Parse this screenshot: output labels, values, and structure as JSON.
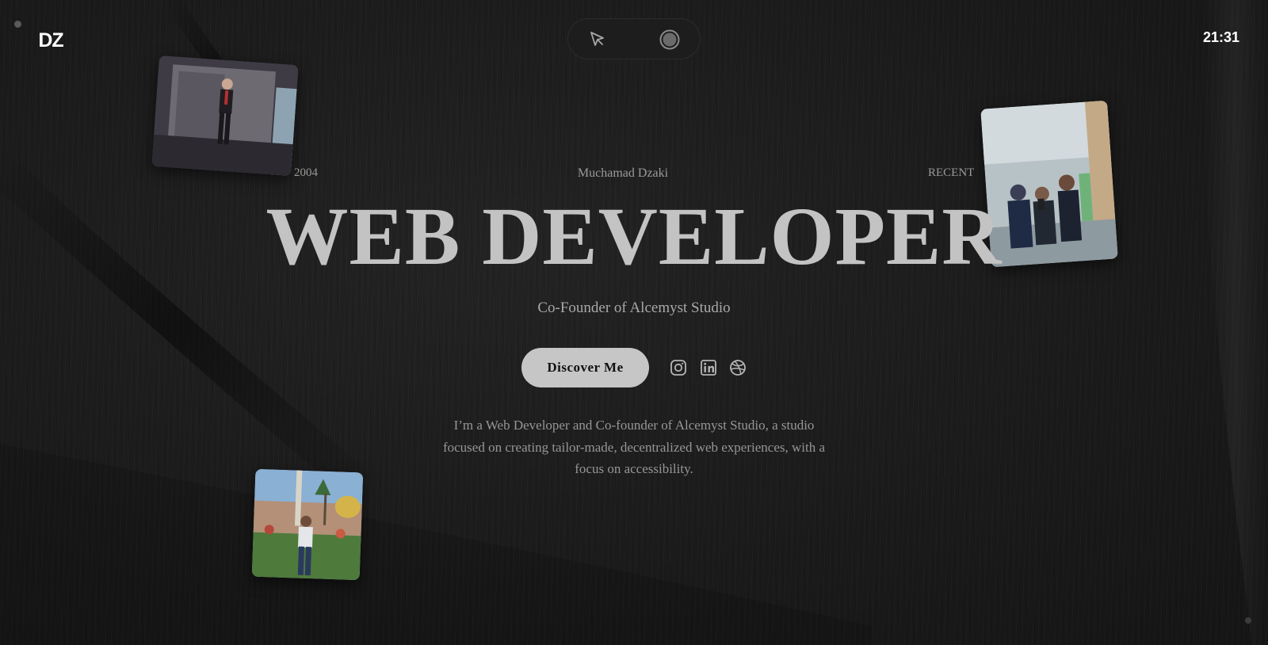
{
  "brand": {
    "logo_text": "DZ"
  },
  "clock": {
    "time": "21:31"
  },
  "cursor_toggle": {
    "options": [
      {
        "icon": "arrow-cursor-icon"
      },
      {
        "icon": "circle-cursor-icon"
      }
    ]
  },
  "hero": {
    "year_label": "2004",
    "name": "Muchamad Dzaki",
    "recent_label": "RECENT",
    "title": "WEB DEVELOPER",
    "subtitle": "Co-Founder of Alcemyst Studio",
    "cta_label": "Discover Me",
    "bio": "I’m a Web Developer and Co-founder of Alcemyst Studio, a studio focused on creating tailor-made, decentralized web experiences, with a focus on accessibility."
  },
  "social_links": [
    {
      "icon": "instagram-icon"
    },
    {
      "icon": "linkedin-icon"
    },
    {
      "icon": "dribbble-icon"
    }
  ],
  "photos": [
    {
      "subject": "portrait-formal"
    },
    {
      "subject": "group-selfie"
    },
    {
      "subject": "mosque-garden"
    }
  ],
  "colors": {
    "background": "#1a1a1a",
    "headline": "#c3c3c3",
    "button": "#c6c6c6",
    "muted_text": "#969696"
  }
}
